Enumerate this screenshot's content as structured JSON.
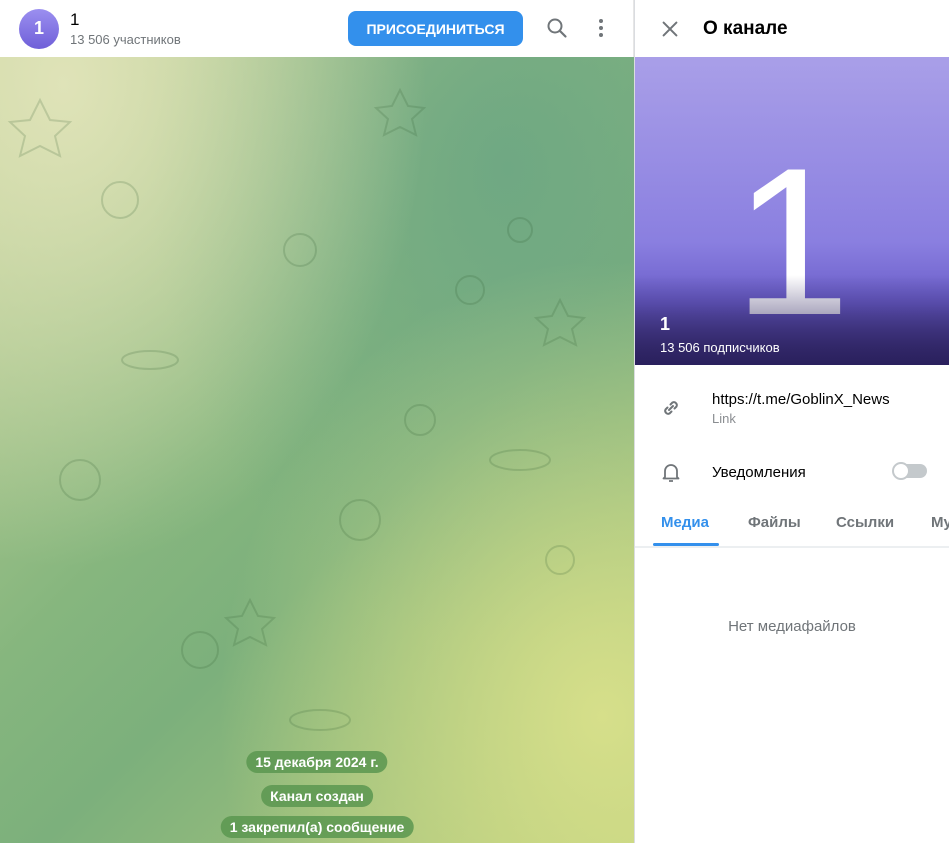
{
  "chat": {
    "avatar_letter": "1",
    "title": "1",
    "subtitle": "13 506 участников",
    "join_label": "ПРИСОЕДИНИТЬСЯ",
    "messages": [
      "15 декабря 2024 г.",
      "Канал создан",
      "1 закрепил(а) сообщение"
    ]
  },
  "panel": {
    "title": "О канале",
    "cover_letter": "1",
    "name": "1",
    "subscribers": "13 506 подписчиков",
    "link": "https://t.me/GoblinX_News",
    "link_label": "Link",
    "notifications_label": "Уведомления",
    "notifications_on": false,
    "tabs": [
      "Медиа",
      "Файлы",
      "Ссылки",
      "Музыка"
    ],
    "empty_text": "Нет медиафайлов"
  },
  "colors": {
    "accent": "#3390ec"
  }
}
